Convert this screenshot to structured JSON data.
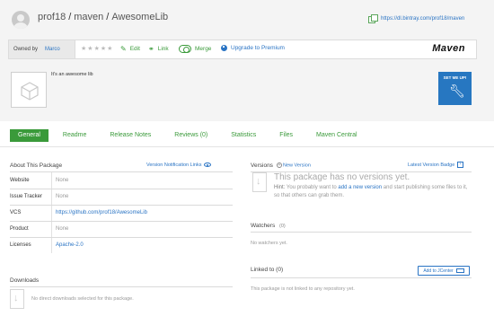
{
  "header": {
    "breadcrumb": {
      "owner": "prof18",
      "repo": "maven",
      "package": "AwesomeLib",
      "separator": "/"
    },
    "download_url": "https://dl.bintray.com/prof18/maven"
  },
  "toolbar": {
    "owned_by_label": "Owned by",
    "owner": "Marco",
    "stars_count": 5,
    "edit_label": "Edit",
    "link_label": "Link",
    "merge_label": "Merge",
    "upgrade_label": "Upgrade to Premium",
    "logo_text": "Maven"
  },
  "package": {
    "description": "It's an awesome lib",
    "set_me_up_label": "SET ME UP!"
  },
  "tabs": [
    {
      "label": "General",
      "active": true
    },
    {
      "label": "Readme"
    },
    {
      "label": "Release Notes"
    },
    {
      "label": "Reviews (0)"
    },
    {
      "label": "Statistics"
    },
    {
      "label": "Files"
    },
    {
      "label": "Maven Central"
    }
  ],
  "about": {
    "title": "About This Package",
    "notification_link": "Version Notification Links",
    "rows": [
      {
        "label": "Website",
        "value": "None"
      },
      {
        "label": "Issue Tracker",
        "value": "None"
      },
      {
        "label": "VCS",
        "value": "https://github.com/prof18/AwesomeLib"
      },
      {
        "label": "Product",
        "value": "None"
      },
      {
        "label": "Licenses",
        "value": "Apache-2.0"
      }
    ]
  },
  "downloads": {
    "title": "Downloads",
    "empty_text": "No direct downloads selected for this package."
  },
  "versions": {
    "title": "Versions",
    "new_version_label": "New Version",
    "latest_badge_label": "Latest Version Badge",
    "empty_title": "This package has no versions yet.",
    "hint_label": "Hint:",
    "hint_before": "You probably want to",
    "hint_link": "add a new version",
    "hint_after": "and start publishing some files to it, so that others can grab them."
  },
  "watchers": {
    "title": "Watchers",
    "count": "(0)",
    "empty_text": "No watchers yet."
  },
  "linked": {
    "title": "Linked to (0)",
    "jcenter_label": "Add to JCenter",
    "empty_text": "This package is not linked to any repository yet."
  },
  "colors": {
    "accent_green": "#3a9a3a",
    "link_blue": "#2a74c4",
    "setme_blue": "#2777c1"
  }
}
